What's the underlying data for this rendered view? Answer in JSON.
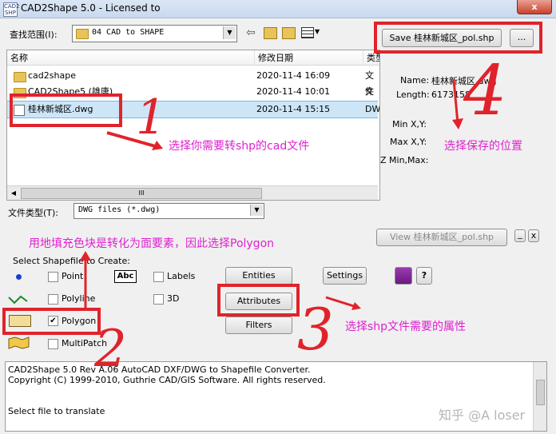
{
  "window": {
    "title": "CAD2Shape 5.0 - Licensed to",
    "app_icon_text": "CAD2 SHP",
    "close_label": "x"
  },
  "lookin": {
    "label": "查找范围(I):",
    "value": "04 CAD to SHAPE"
  },
  "filelist": {
    "headers": [
      "名称",
      "修改日期",
      "类型"
    ],
    "rows": [
      {
        "name": "cad2shape",
        "date": "2020-11-4 16:09",
        "type": "文件"
      },
      {
        "name": "CAD2Shape5 (雄唐)",
        "date": "2020-11-4 10:01",
        "type": "文件"
      },
      {
        "name": "桂林新城区.dwg",
        "date": "2020-11-4 15:15",
        "type": "DW"
      }
    ],
    "scroll_glyph": "III"
  },
  "filetype": {
    "label": "文件类型(T):",
    "value": "DWG files (*.dwg)"
  },
  "save": {
    "button_label": "Save 桂林新城区_pol.shp",
    "browse_label": "..."
  },
  "info": {
    "name_label": "Name:",
    "name_value": "桂林新城区.dwg",
    "length_label": "Length:",
    "length_value": "6173158",
    "minxy_label": "Min X,Y:",
    "maxxy_label": "Max X,Y:",
    "zminmax_label": "Z Min,Max:"
  },
  "view_button": "View 桂林新城区_pol.shp",
  "small_btns": {
    "minus": "_",
    "close": "x"
  },
  "shapefile": {
    "section_label": "Select Shapefile to Create:",
    "types": [
      {
        "label": "Point",
        "checked": false
      },
      {
        "label": "Polyline",
        "checked": false
      },
      {
        "label": "Polygon",
        "checked": true
      },
      {
        "label": "MultiPatch",
        "checked": false
      }
    ],
    "labels_option": "Labels",
    "d3_option": "3D",
    "abc_icon": "Abc"
  },
  "buttons": {
    "entities": "Entities",
    "attributes": "Attributes",
    "filters": "Filters",
    "settings": "Settings",
    "help": "?"
  },
  "log": {
    "line1": "CAD2Shape 5.0 Rev A.06 AutoCAD DXF/DWG to Shapefile Converter.",
    "line2": "Copyright (C) 1999-2010, Guthrie CAD/GIS Software. All rights reserved.",
    "status": "Select file to translate"
  },
  "annotations": {
    "step1": "选择你需要转shp的cad文件",
    "step2": "用地填充色块是转化为面要素，因此选择Polygon",
    "step3": "选择shp文件需要的属性",
    "step4": "选择保存的位置",
    "num1": "1",
    "num2": "2",
    "num3": "3",
    "num4": "4"
  },
  "watermark": "知乎 @A loser",
  "colors": {
    "annotation": "#e020d0",
    "highlight": "#e0232b"
  }
}
